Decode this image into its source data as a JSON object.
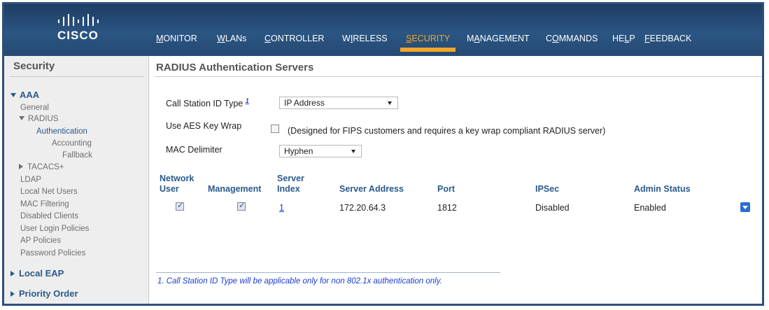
{
  "brand": {
    "name": "cisco",
    "logo_text": "CISCO"
  },
  "colors": {
    "topbar": "#254a73",
    "active_nav": "#f3a62a",
    "link": "#1a3dd1",
    "heading_blue": "#2a5a8a"
  },
  "nav": {
    "items": [
      {
        "pre": "",
        "u": "M",
        "post": "ONITOR"
      },
      {
        "pre": "",
        "u": "W",
        "post": "LANs"
      },
      {
        "pre": "",
        "u": "C",
        "post": "ONTROLLER"
      },
      {
        "pre": "W",
        "u": "I",
        "post": "RELESS"
      },
      {
        "pre": "",
        "u": "S",
        "post": "ECURITY"
      },
      {
        "pre": "M",
        "u": "A",
        "post": "NAGEMENT"
      },
      {
        "pre": "C",
        "u": "O",
        "post": "MMANDS"
      },
      {
        "pre": "HE",
        "u": "L",
        "post": "P"
      },
      {
        "pre": "",
        "u": "F",
        "post": "EEDBACK"
      }
    ],
    "active": "SECURITY"
  },
  "sidebar": {
    "title": "Security",
    "aaa": "AAA",
    "general": "General",
    "radius": "RADIUS",
    "authentication": "Authentication",
    "accounting": "Accounting",
    "fallback": "Fallback",
    "tacacs": "TACACS+",
    "ldap": "LDAP",
    "local_net_users": "Local Net Users",
    "mac_filtering": "MAC Filtering",
    "disabled_clients": "Disabled Clients",
    "user_login_policies": "User Login Policies",
    "ap_policies": "AP Policies",
    "password_policies": "Password Policies",
    "local_eap": "Local EAP",
    "priority_order": "Priority Order"
  },
  "page": {
    "title": "RADIUS Authentication Servers",
    "call_station_label": "Call Station ID Type",
    "call_station_sup": "1",
    "call_station_value": "IP Address",
    "aes_label": "Use AES Key Wrap",
    "aes_checked": false,
    "aes_note": "(Designed for FIPS customers and requires a key wrap compliant RADIUS server)",
    "mac_delim_label": "MAC Delimiter",
    "mac_delim_value": "Hyphen"
  },
  "table": {
    "headers": {
      "network_user_1": "Network",
      "network_user_2": "User",
      "management": "Management",
      "server_index_1": "Server",
      "server_index_2": "Index",
      "server_address": "Server Address",
      "port": "Port",
      "ipsec": "IPSec",
      "admin_status": "Admin Status"
    },
    "rows": [
      {
        "network_user": true,
        "management": true,
        "server_index": "1",
        "server_address": "172.20.64.3",
        "port": "1812",
        "ipsec": "Disabled",
        "admin_status": "Enabled"
      }
    ]
  },
  "footnote": "1. Call Station ID Type will be applicable only for non 802.1x authentication only."
}
